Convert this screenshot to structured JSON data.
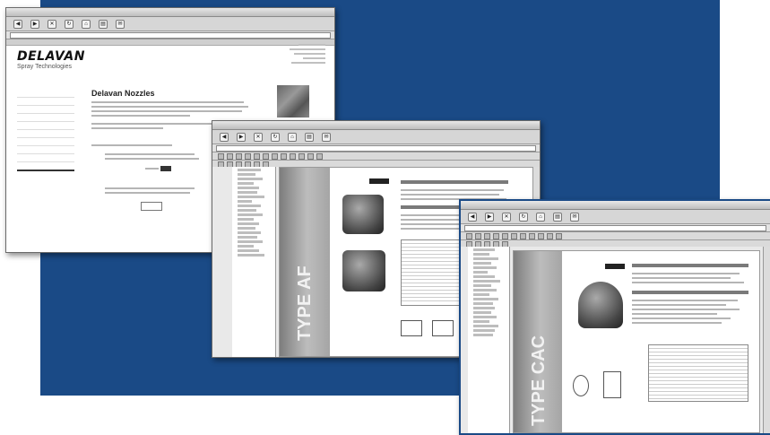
{
  "colors": {
    "panel_blue": "#1a4a86",
    "window_gray": "#d6d6d6"
  },
  "browser": {
    "logo": "DELAVAN",
    "tagline": "Spray Technologies",
    "heading": "Delavan Nozzles",
    "toolbar_icons": [
      "back-icon",
      "forward-icon",
      "stop-icon",
      "refresh-icon",
      "home-icon",
      "print-icon",
      "mail-icon"
    ]
  },
  "pdf1": {
    "title": "TYPE AF"
  },
  "pdf2": {
    "title": "TYPE CAC"
  }
}
